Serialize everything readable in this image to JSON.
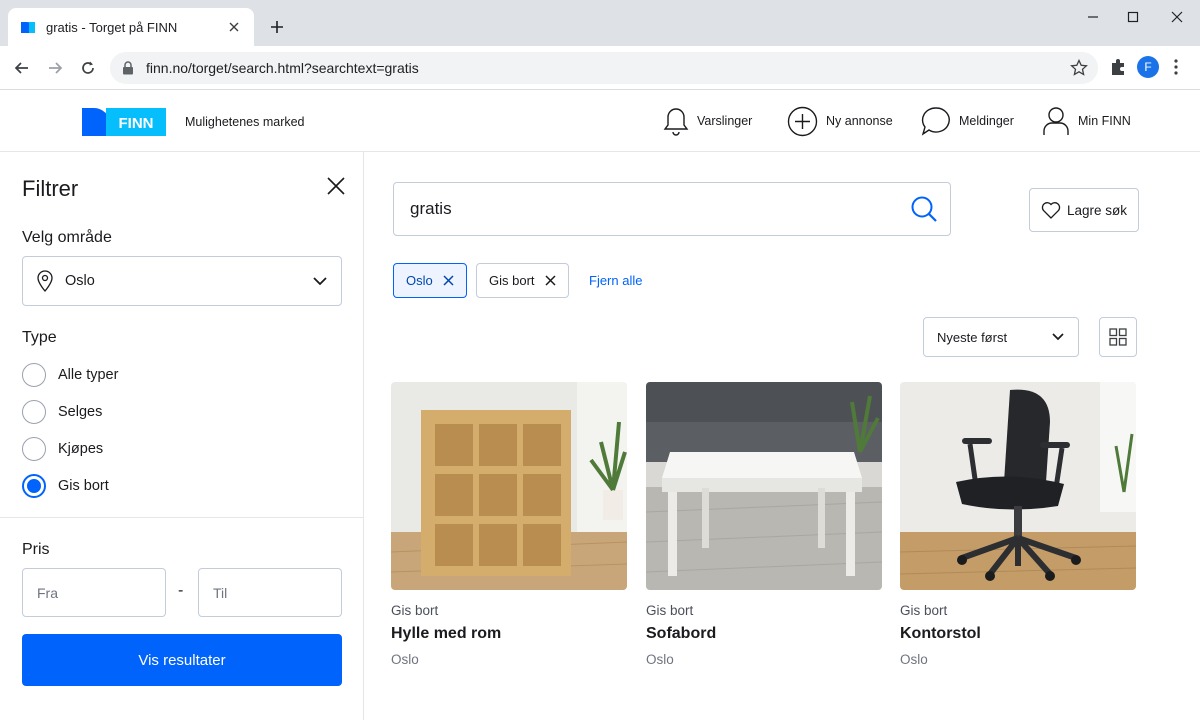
{
  "browser": {
    "tab_title": "gratis - Torget på FINN",
    "url": "finn.no/torget/search.html?searchtext=gratis",
    "profile_initial": "F"
  },
  "header": {
    "logo_text": "FINN",
    "tagline": "Mulighetenes marked",
    "nav": [
      {
        "label": "Varslinger",
        "icon": "bell-icon"
      },
      {
        "label": "Ny annonse",
        "icon": "plus-circle-icon"
      },
      {
        "label": "Meldinger",
        "icon": "chat-bubble-icon"
      },
      {
        "label": "Min FINN",
        "icon": "user-icon"
      }
    ]
  },
  "filter": {
    "title": "Filtrer",
    "area_label": "Velg område",
    "area_value": "Oslo",
    "type_label": "Type",
    "types": [
      {
        "label": "Alle typer",
        "checked": false
      },
      {
        "label": "Selges",
        "checked": false
      },
      {
        "label": "Kjøpes",
        "checked": false
      },
      {
        "label": "Gis bort",
        "checked": true
      }
    ],
    "price_label": "Pris",
    "price_from_placeholder": "Fra",
    "price_to_placeholder": "Til",
    "price_separator": "-",
    "submit_label": "Vis resultater"
  },
  "search": {
    "query": "gratis",
    "save_label": "Lagre søk",
    "chips": [
      {
        "label": "Oslo",
        "active": true
      },
      {
        "label": "Gis bort",
        "active": false
      }
    ],
    "clear_all": "Fjern alle",
    "sort_value": "Nyeste først"
  },
  "results": [
    {
      "kind": "Gis bort",
      "title": "Hylle med rom",
      "location": "Oslo",
      "image": "bookshelf-photo"
    },
    {
      "kind": "Gis bort",
      "title": "Sofabord",
      "location": "Oslo",
      "image": "coffee-table-photo"
    },
    {
      "kind": "Gis bort",
      "title": "Kontorstol",
      "location": "Oslo",
      "image": "office-chair-photo"
    }
  ],
  "colors": {
    "brand_blue": "#0063fb",
    "logo_dark": "#0063fb",
    "logo_light": "#06befb"
  }
}
